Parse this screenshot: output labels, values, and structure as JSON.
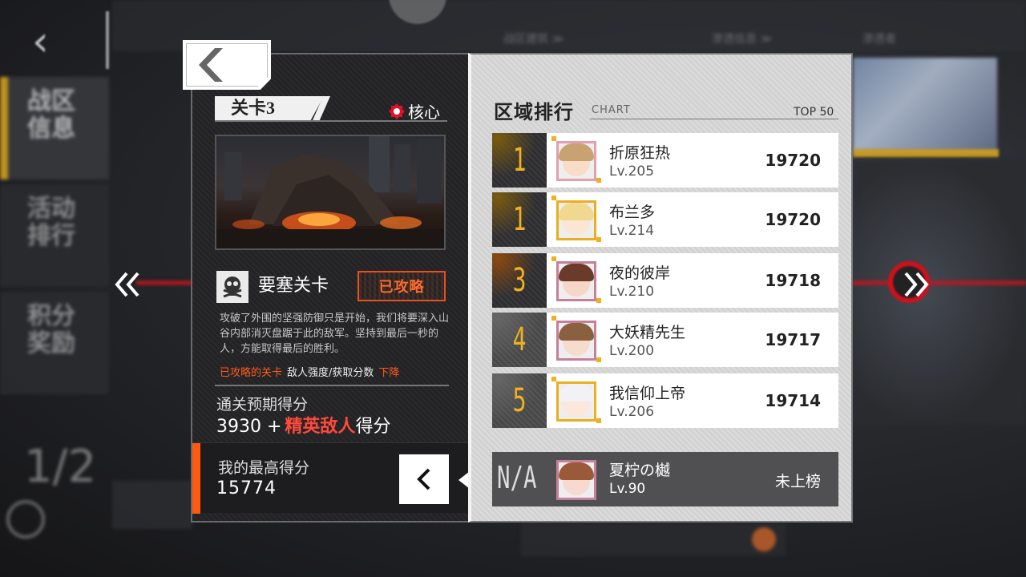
{
  "background": {
    "top_tabs": [
      "战区建筑 ≫",
      "渗透信息 ≫",
      "渗透者"
    ],
    "sidebar_items": [
      "战区信息",
      "活动排行",
      "积分奖励"
    ],
    "progress": "1/2"
  },
  "stage": {
    "label": "关卡3",
    "core_label": "核心",
    "type_label": "要塞关卡",
    "cleared_label": "已攻略",
    "description": "攻破了外围的坚强防御只是开始，我们将要深入山谷内部消灭盘踞于此的敌军。坚持到最后一秒的人，方能取得最后的胜利。",
    "rule_prefix": "已攻略的关卡",
    "rule_middle": "敌人强度/获取分数",
    "rule_suffix": "下降",
    "expected_label": "通关预期得分",
    "expected_base": "3930 +",
    "expected_elite": "精英敌人",
    "expected_tail": "得分",
    "best_label": "我的最高得分",
    "best_value": "15774"
  },
  "ranking": {
    "title": "区域排行",
    "chart_label": "CHART",
    "top_label": "TOP 50",
    "entries": [
      {
        "rank": "1",
        "name": "折原狂热",
        "level": "Lv.205",
        "score": "19720",
        "frame_color": "#e0a0b0",
        "hair_color": "#c9a272",
        "face_color": "#f8dcc8"
      },
      {
        "rank": "1",
        "name": "布兰多",
        "level": "Lv.214",
        "score": "19720",
        "frame_color": "#e8b020",
        "hair_color": "#f0d890",
        "face_color": "#fae6d2"
      },
      {
        "rank": "3",
        "name": "夜的彼岸",
        "level": "Lv.210",
        "score": "19718",
        "frame_color": "#c4809a",
        "hair_color": "#6a3a2a",
        "face_color": "#f6d6c6"
      },
      {
        "rank": "4",
        "name": "大妖精先生",
        "level": "Lv.200",
        "score": "19717",
        "frame_color": "#c4809a",
        "hair_color": "#8a6040",
        "face_color": "#f6dccc"
      },
      {
        "rank": "5",
        "name": "我信仰上帝",
        "level": "Lv.206",
        "score": "19714",
        "frame_color": "#e8b020",
        "hair_color": "#f2f2f6",
        "face_color": "#fbe8da"
      }
    ],
    "me": {
      "rank": "N/A",
      "name": "夏柠の樾",
      "level": "Lv.90",
      "status": "未上榜",
      "hair_color": "#9a5a3a",
      "face_color": "#f6dad0"
    }
  },
  "colors": {
    "accent_orange": "#ff5a10",
    "rank_gold": "#f0b020",
    "elite_red": "#ff4a3a",
    "bg_red_line": "#c9141e"
  }
}
